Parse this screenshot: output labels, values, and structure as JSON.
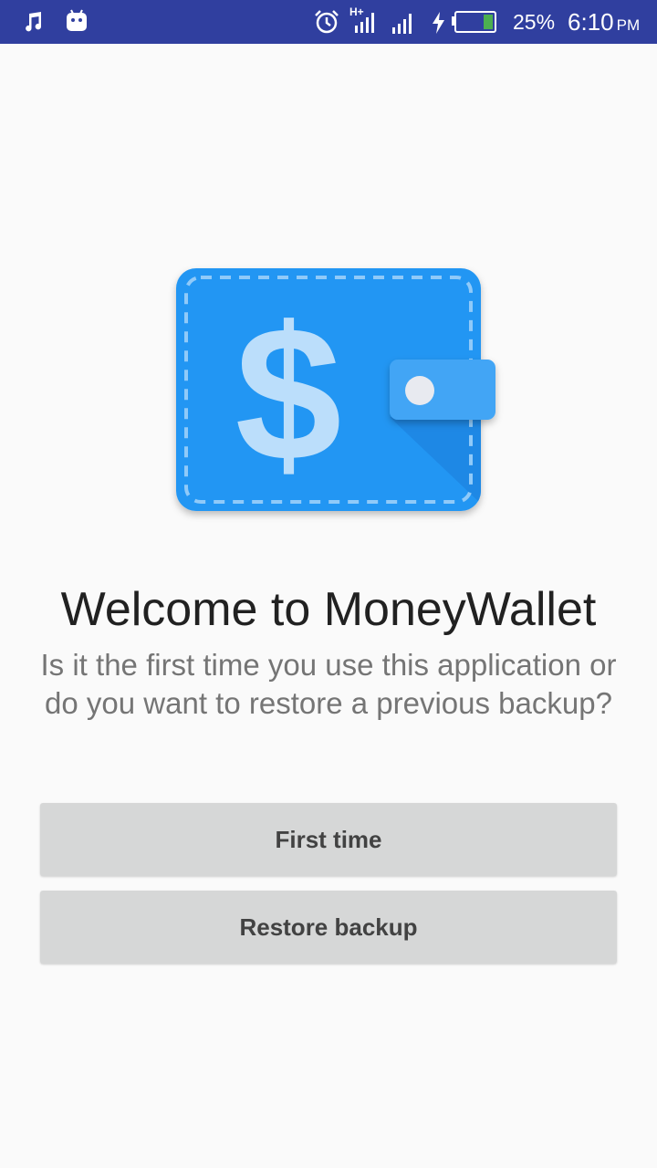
{
  "status_bar": {
    "background": "#303f9f",
    "left_icons": [
      "music-note-icon",
      "android-icon"
    ],
    "right_icons": [
      "alarm-icon",
      "signal-hplus-icon",
      "signal-icon",
      "charging-bolt-icon",
      "battery-icon"
    ],
    "battery_percent": "25%",
    "time": "6:10",
    "am_pm": "PM"
  },
  "logo": {
    "icon": "wallet-icon",
    "symbol": "$",
    "colors": {
      "wallet": "#2196f3",
      "strap": "#42a5f5",
      "dollar": "#bbdefb",
      "stitch": "#90caf9",
      "button": "#e8eaf0"
    }
  },
  "welcome": {
    "title": "Welcome to MoneyWallet",
    "subtitle": "Is it the first time you use this application or do you want to restore a previous backup?"
  },
  "actions": {
    "first_time_label": "First time",
    "restore_label": "Restore backup",
    "button_color": "#d6d7d7"
  }
}
